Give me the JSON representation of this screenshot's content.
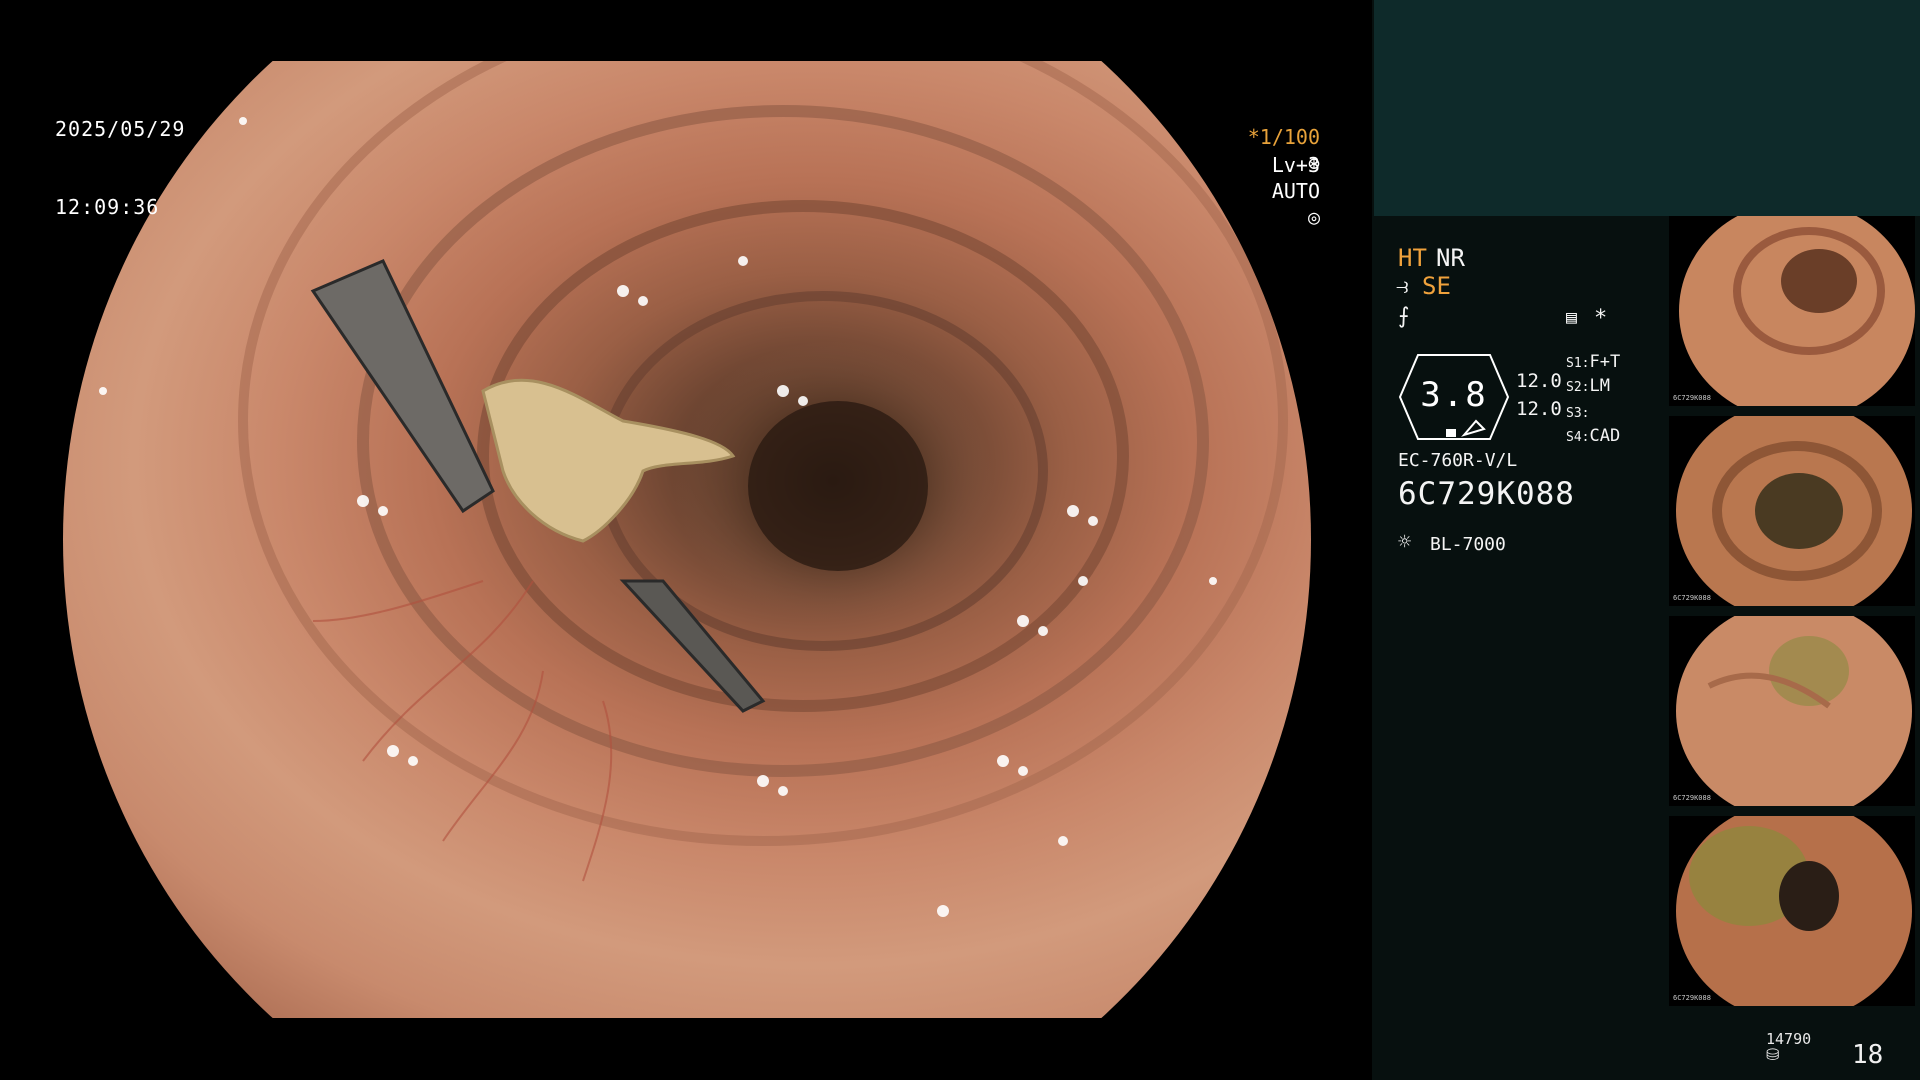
{
  "overlay": {
    "date": "2025/05/29",
    "time": "12:09:36",
    "magnification": "*1/100",
    "level": "Lv+3",
    "exposure_mode": "AUTO"
  },
  "panel": {
    "ht": "HT",
    "nr": "NR",
    "se": "SE",
    "asterisk": "*",
    "gauge_value": "3.8",
    "scale_top": "12.0",
    "scale_bottom": "12.0",
    "settings": [
      {
        "key": "S1",
        "value": "F+T"
      },
      {
        "key": "S2",
        "value": "LM"
      },
      {
        "key": "S3",
        "value": ""
      },
      {
        "key": "S4",
        "value": "CAD"
      }
    ],
    "scope_model": "EC-760R-V/L",
    "serial": "6C729K088",
    "light_source": "BL-7000",
    "accent_color": "#f0a23c",
    "image_count": "14790",
    "page_number": "18"
  },
  "thumbnails": [
    {
      "caption_serial": "6C729K088"
    },
    {
      "caption_serial": "6C729K088"
    },
    {
      "caption_serial": "6C729K088"
    },
    {
      "caption_serial": "6C729K088"
    }
  ]
}
